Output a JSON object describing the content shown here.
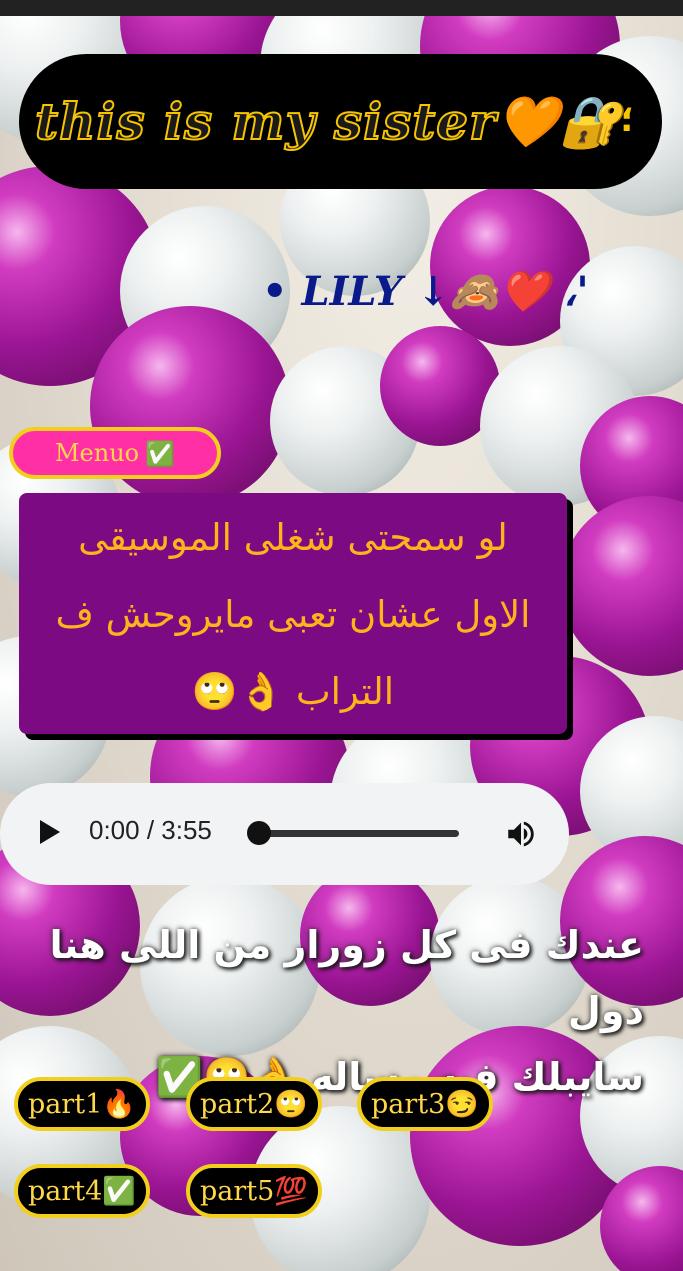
{
  "header": {
    "title": "this is my sister🧡🔐",
    "title_suffix": "؛"
  },
  "subtitle": "• LILY ↓🙈❤️ ،'",
  "menu_button": {
    "label": "Menuo",
    "check": "✅"
  },
  "message": {
    "lines": [
      "لو سمحتى شغلى الموسيقى",
      "الاول عشان تعبى مايروحش ف",
      "التراب 👌🙄"
    ]
  },
  "audio_player": {
    "time": "0:00 / 3:55",
    "play_icon": "play-icon",
    "volume_icon": "volume-icon",
    "progress": 0
  },
  "info": {
    "lines": [
      "عندك فى كل زورار من اللى هنا دول",
      "سايبلك فيه رساله 👌🙄✅"
    ]
  },
  "parts": [
    {
      "label": "part1🔥"
    },
    {
      "label": "part2🙄"
    },
    {
      "label": "part3😏"
    },
    {
      "label": "part4✅"
    },
    {
      "label": "part5💯"
    }
  ],
  "colors": {
    "accent_yellow": "#f6c400",
    "menu_pink": "#ff2fa6",
    "message_purple": "#7c0a83",
    "message_text": "#ffb31a",
    "lily_blue": "#0b1a8a"
  }
}
